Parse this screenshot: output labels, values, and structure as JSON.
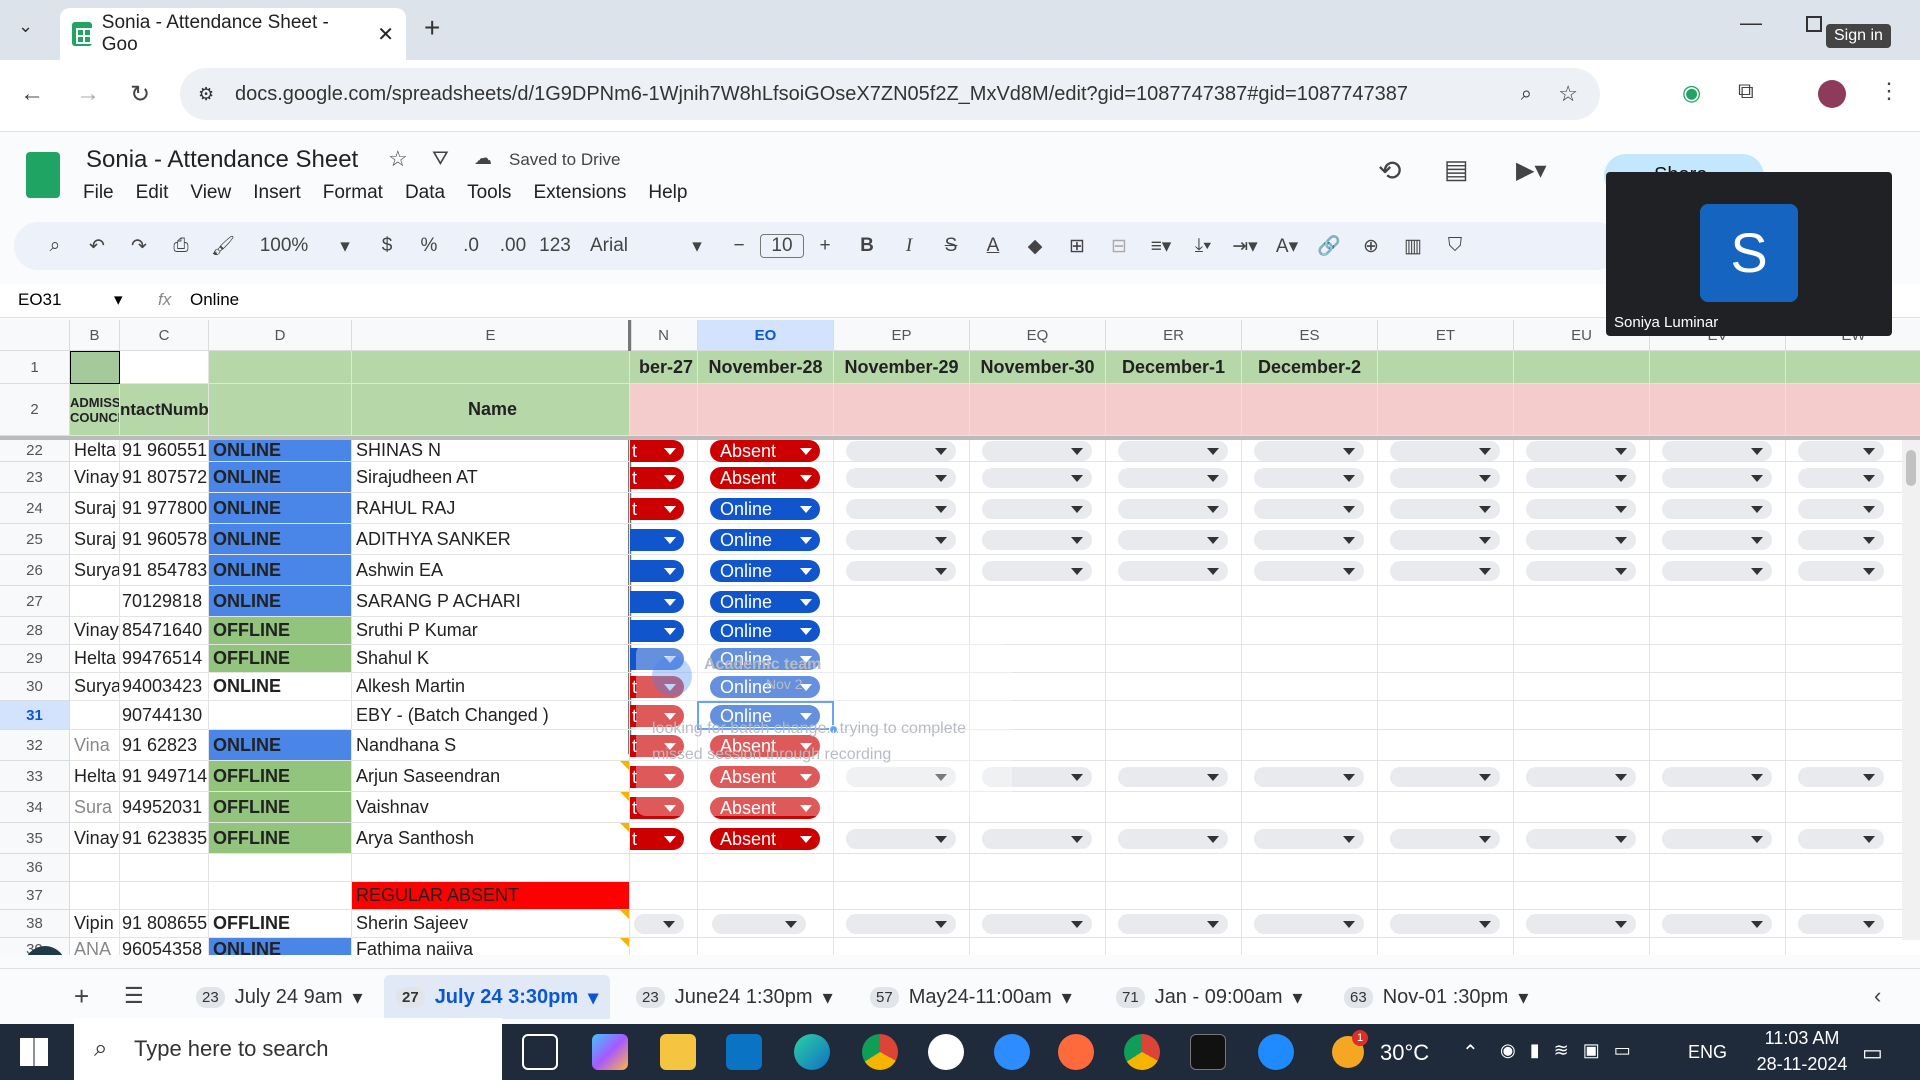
{
  "browser": {
    "tab_title": "Sonia - Attendance Sheet - Goo",
    "url": "docs.google.com/spreadsheets/d/1G9DPNm6-1Wjnih7W8hLfsoiGOseX7ZN05f2Z_MxVd8M/edit?gid=1087747387#gid=1087747387",
    "signin_tooltip": "Sign in"
  },
  "doc": {
    "title": "Sonia - Attendance Sheet",
    "saved": "Saved to Drive",
    "menu": [
      "File",
      "Edit",
      "View",
      "Insert",
      "Format",
      "Data",
      "Tools",
      "Extensions",
      "Help"
    ],
    "share": "Share"
  },
  "toolbar": {
    "zoom": "100%",
    "currency": "$",
    "percent": "%",
    "dec_minus": ".0",
    "dec_plus": ".00",
    "format123": "123",
    "font": "Arial",
    "font_size": "10"
  },
  "formula": {
    "cell_ref": "EO31",
    "fx": "fx",
    "value": "Online"
  },
  "columns": {
    "left": [
      "B",
      "C",
      "D",
      "E"
    ],
    "right": [
      "N",
      "EO",
      "EP",
      "EQ",
      "ER",
      "ES",
      "ET",
      "EU",
      "EV",
      "EW"
    ]
  },
  "header_rows": {
    "row1_dates": [
      "ber-27",
      "November-28",
      "November-29",
      "November-30",
      "December-1",
      "December-2"
    ],
    "row2": {
      "b": "ADMISSION COUNCEL",
      "c": "ntactNumber",
      "e": "Name"
    }
  },
  "rows": [
    {
      "n": "22",
      "b": "Helta",
      "c": "91 960551",
      "d": "ONLINE",
      "dtype": "online",
      "e": "SHINAS N",
      "n27": "red",
      "eo": "Absent",
      "dd": true
    },
    {
      "n": "23",
      "b": "Vinay",
      "c": "91 807572",
      "d": "ONLINE",
      "dtype": "online",
      "e": "Sirajudheen AT",
      "n27": "red",
      "eo": "Absent",
      "dd": true
    },
    {
      "n": "24",
      "b": "Suraj",
      "c": "91 977800",
      "d": "ONLINE",
      "dtype": "online",
      "e": "RAHUL RAJ",
      "n27": "red",
      "eo": "Online",
      "dd": true
    },
    {
      "n": "25",
      "b": "Suraj",
      "c": "91 960578",
      "d": "ONLINE",
      "dtype": "online",
      "e": "ADITHYA SANKER",
      "n27": "blue",
      "eo": "Online",
      "dd": true
    },
    {
      "n": "26",
      "b": "Surya",
      "c": "91 854783",
      "d": "ONLINE",
      "dtype": "online",
      "e": "Ashwin EA",
      "n27": "blue",
      "eo": "Online",
      "dd": true
    },
    {
      "n": "27",
      "b": "",
      "c": "70129818",
      "d": "ONLINE",
      "dtype": "online",
      "e": "SARANG P ACHARI",
      "n27": "blue",
      "eo": "Online",
      "dd": false
    },
    {
      "n": "28",
      "b": "Vinay",
      "c": "85471640",
      "d": "OFFLINE",
      "dtype": "offline",
      "e": "Sruthi P Kumar",
      "n27": "blue",
      "eo": "Online",
      "dd": false
    },
    {
      "n": "29",
      "b": "Helta",
      "c": "99476514",
      "d": "OFFLINE",
      "dtype": "offline",
      "e": "Shahul K",
      "n27": "blue",
      "eo": "Online",
      "dd": false
    },
    {
      "n": "30",
      "b": "Surya",
      "c": "94003423",
      "d": "ONLINE",
      "dtype": "plain",
      "e": "Alkesh Martin",
      "n27": "red",
      "eo": "Online",
      "dd": false
    },
    {
      "n": "31",
      "b": "",
      "c": "90744130",
      "d": "",
      "dtype": "plain",
      "e": "EBY - (Batch Changed )",
      "n27": "red",
      "eo": "Online",
      "dd": false
    },
    {
      "n": "32",
      "b": "Vina",
      "c": "91 62823",
      "d": "ONLINE",
      "dtype": "online",
      "e": "Nandhana S",
      "n27": "red",
      "eo": "Absent",
      "dd": false
    },
    {
      "n": "33",
      "b": "Helta",
      "c": "91 949714",
      "d": "OFFLINE",
      "dtype": "offline",
      "e": "Arjun Saseendran",
      "n27": "red",
      "eo": "Absent",
      "dd": true
    },
    {
      "n": "34",
      "b": "Sura",
      "c": "94952031",
      "d": "OFFLINE",
      "dtype": "offline",
      "e": "Vaishnav",
      "n27": "red",
      "eo": "Absent",
      "dd": false
    },
    {
      "n": "35",
      "b": "Vinay",
      "c": "91 623835",
      "d": "OFFLINE",
      "dtype": "offline",
      "e": "Arya Santhosh",
      "n27": "red",
      "eo": "Absent",
      "dd": true
    },
    {
      "n": "36",
      "b": "",
      "c": "",
      "d": "",
      "dtype": "plain",
      "e": "",
      "n27": "",
      "eo": "",
      "dd": false
    },
    {
      "n": "37",
      "b": "",
      "c": "",
      "d": "",
      "dtype": "plain",
      "e": "REGULAR ABSENT",
      "n27": "",
      "eo": "",
      "dd": false
    },
    {
      "n": "38",
      "b": "Vipin",
      "c": "91 808655",
      "d": "OFFLINE",
      "dtype": "plain",
      "e": "Sherin Sajeev",
      "n27": "",
      "eo": "",
      "dd": true
    },
    {
      "n": "39",
      "b": "ANA",
      "c": "96054358",
      "d": "ONLINE",
      "dtype": "online",
      "e": "Fathima naiiva",
      "n27": "",
      "eo": "",
      "dd": false
    }
  ],
  "toast": {
    "name": "Academic team",
    "sub": "Nov 2",
    "body": "looking for batch change...trying to complete missed session through recording"
  },
  "video": {
    "initial": "S",
    "name": "Soniya Luminar"
  },
  "sheets": [
    {
      "count": "23",
      "name": "July 24 9am"
    },
    {
      "count": "27",
      "name": "July 24 3:30pm"
    },
    {
      "count": "23",
      "name": "June24 1:30pm"
    },
    {
      "count": "57",
      "name": "May24-11:00am"
    },
    {
      "count": "71",
      "name": "Jan - 09:00am"
    },
    {
      "count": "63",
      "name": "Nov-01 :30pm"
    }
  ],
  "taskbar": {
    "search": "Type here to search",
    "temp": "30°C",
    "lang": "ENG",
    "time": "11:03 AM",
    "date": "28-11-2024",
    "weather_badge": "1"
  },
  "colors": {
    "online_fill": "#4a86e8",
    "offline_fill": "#93c47d",
    "header_green": "#b6d7a8",
    "header_pink": "#f4cccc",
    "absent_chip": "#cc0000",
    "online_chip": "#1155cc",
    "red_fill": "#ff0000"
  }
}
